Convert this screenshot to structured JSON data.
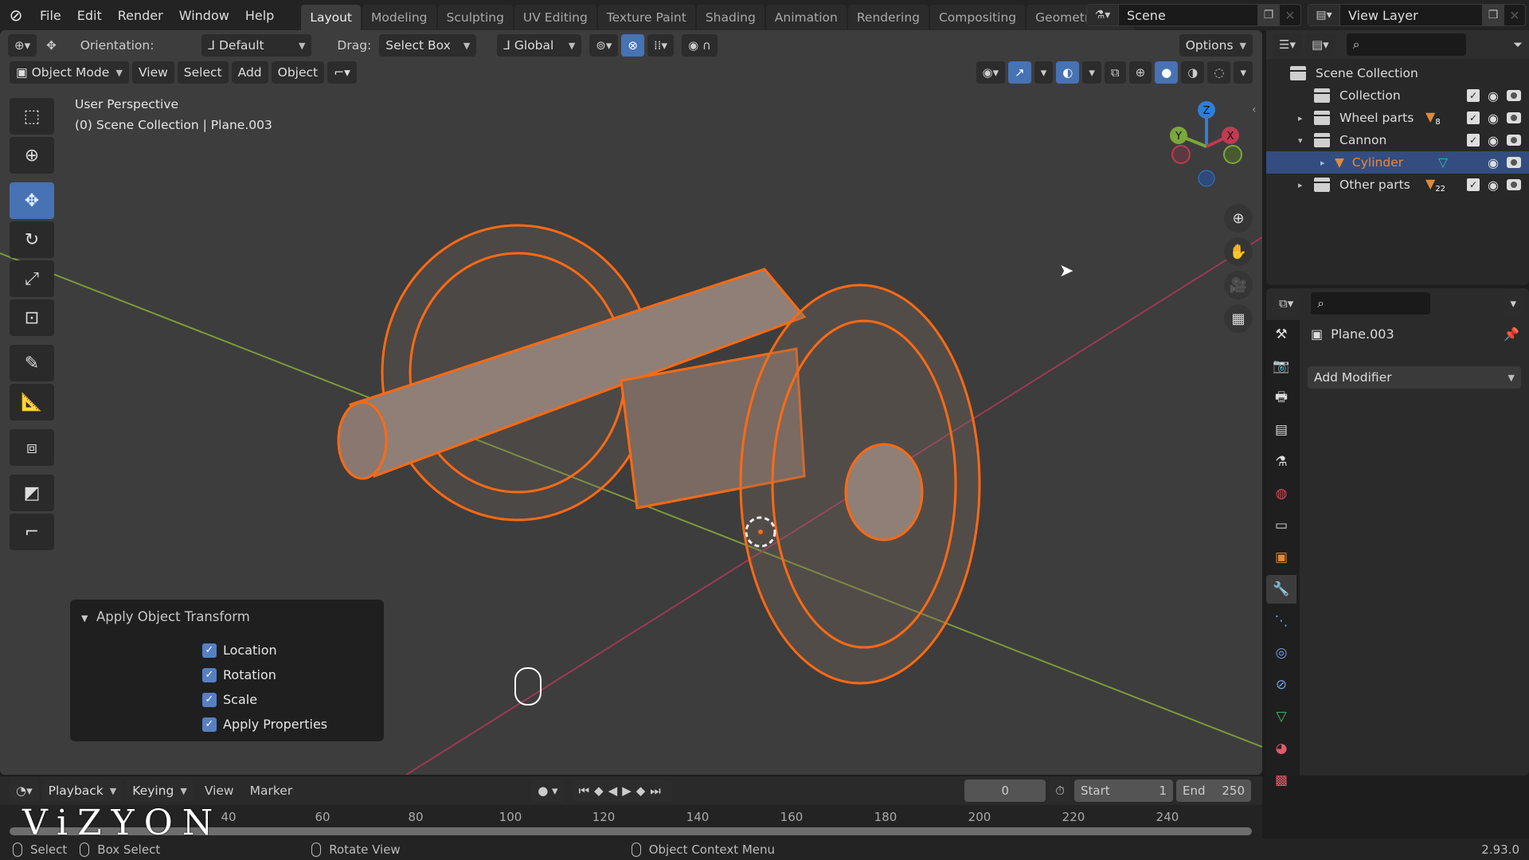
{
  "topbar": {
    "logo": "blender-logo",
    "menus": [
      "File",
      "Edit",
      "Render",
      "Window",
      "Help"
    ],
    "workspaces": [
      "Layout",
      "Modeling",
      "Sculpting",
      "UV Editing",
      "Texture Paint",
      "Shading",
      "Animation",
      "Rendering",
      "Compositing",
      "Geometry Nod"
    ],
    "active_workspace": "Layout",
    "scene": "Scene",
    "view_layer": "View Layer"
  },
  "tool_header": {
    "orientation_label": "Orientation:",
    "orientation_value": "Default",
    "drag_label": "Drag:",
    "drag_value": "Select Box",
    "transform_orientation": "Global",
    "options_label": "Options"
  },
  "viewport_header": {
    "mode": "Object Mode",
    "menus": [
      "View",
      "Select",
      "Add",
      "Object"
    ]
  },
  "viewport": {
    "view_name": "User Perspective",
    "context": "(0) Scene Collection | Plane.003",
    "gizmo_axes": {
      "z": "Z",
      "y": "Y",
      "x": "X"
    },
    "colors": {
      "x_axis": "#c03a50",
      "y_axis": "#7aa83a",
      "z_axis": "#2f7fd6",
      "selection": "#ff6a12",
      "background": "#3d3d3d"
    }
  },
  "toolbar": {
    "tools": [
      "select-box",
      "cursor",
      "move",
      "rotate",
      "scale",
      "transform",
      "annotate",
      "measure",
      "add-cube",
      "shear",
      "bend"
    ],
    "active": "move"
  },
  "apply_panel": {
    "title": "Apply Object Transform",
    "options": [
      {
        "label": "Location",
        "checked": true
      },
      {
        "label": "Rotation",
        "checked": true
      },
      {
        "label": "Scale",
        "checked": true
      },
      {
        "label": "Apply Properties",
        "checked": true
      }
    ]
  },
  "outliner": {
    "root": "Scene Collection",
    "rows": [
      {
        "label": "Collection",
        "expand": "",
        "badge": ""
      },
      {
        "label": "Wheel parts",
        "expand": "▸",
        "badge": "8"
      },
      {
        "label": "Cannon",
        "expand": "▾",
        "badge": ""
      },
      {
        "label": "Cylinder",
        "expand": "▸",
        "badge": "",
        "selected": true
      },
      {
        "label": "Other parts",
        "expand": "▸",
        "badge": "22"
      }
    ]
  },
  "properties": {
    "object_name": "Plane.003",
    "add_modifier": "Add Modifier",
    "active_tab": "modifiers"
  },
  "timeline": {
    "menus": [
      "Playback",
      "Keying",
      "View",
      "Marker"
    ],
    "current_frame": "0",
    "start_label": "Start",
    "start": "1",
    "end_label": "End",
    "end": "250",
    "ticks": [
      "40",
      "60",
      "80",
      "100",
      "120",
      "140",
      "160",
      "180",
      "200",
      "220",
      "240"
    ]
  },
  "statusbar": {
    "hints": [
      "Select",
      "Box Select",
      "Rotate View",
      "Object Context Menu"
    ],
    "version": "2.93.0"
  },
  "watermark": "ViZYON"
}
